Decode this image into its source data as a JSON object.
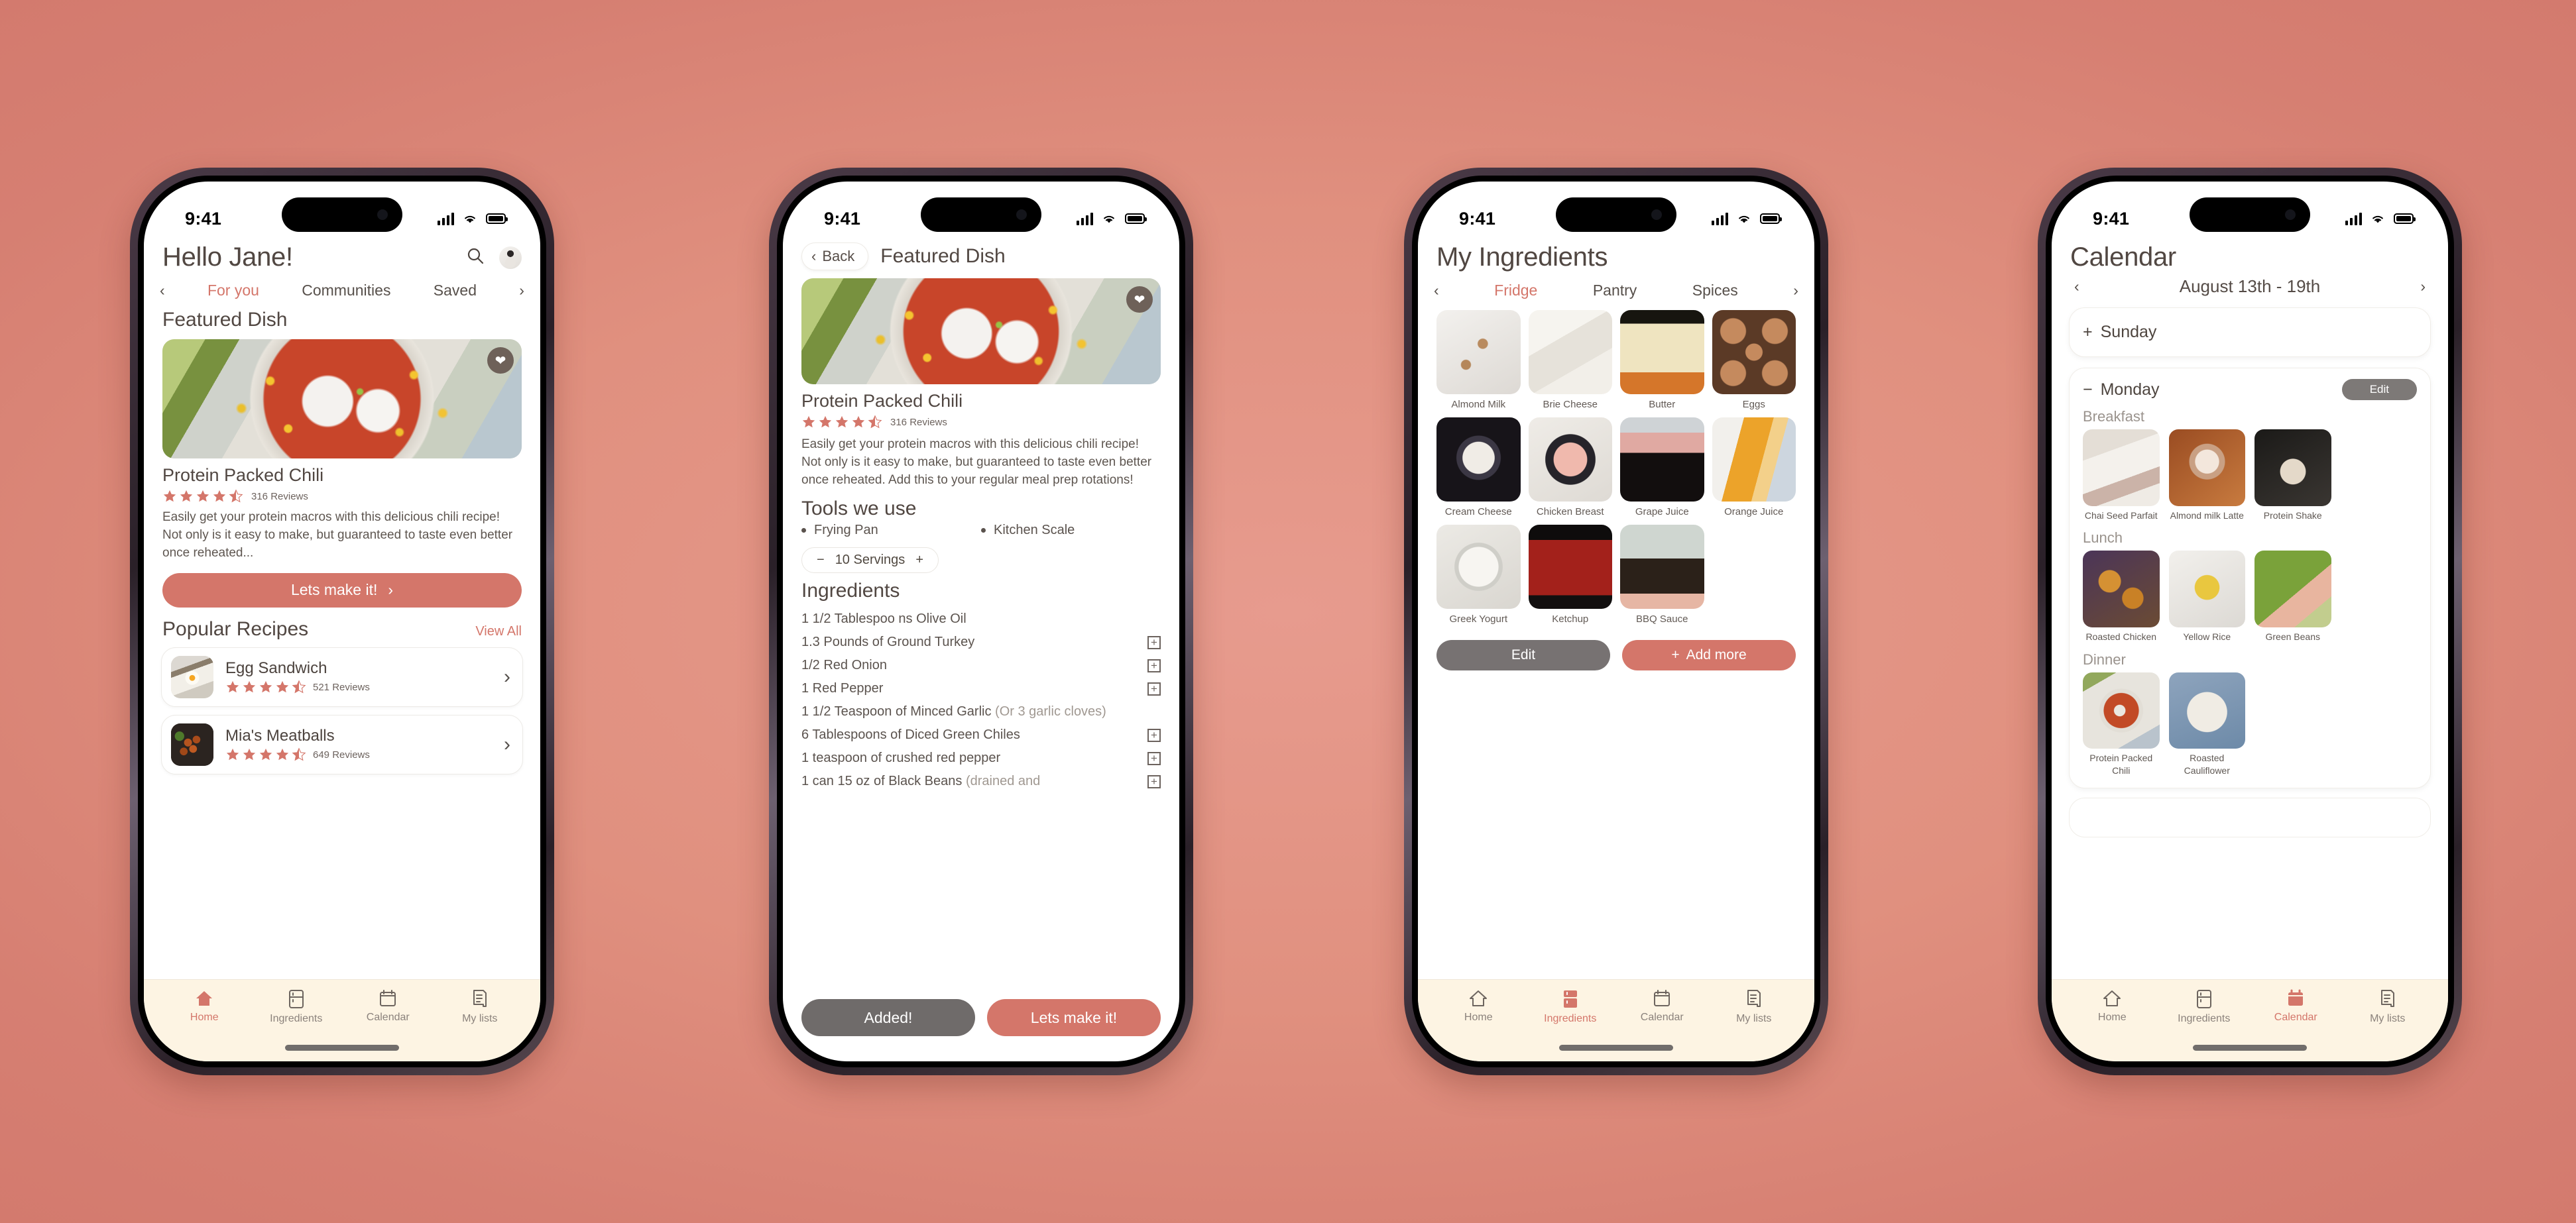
{
  "colors": {
    "accent": "#d4766a",
    "grey_button": "#777272",
    "tabbar_bg": "#fdf4e3",
    "text": "#514742",
    "background": "#d3766c"
  },
  "statusbar": {
    "time": "9:41"
  },
  "nav": {
    "items": [
      {
        "label": "Home",
        "icon": "home-icon"
      },
      {
        "label": "Ingredients",
        "icon": "fridge-icon"
      },
      {
        "label": "Calendar",
        "icon": "calendar-icon"
      },
      {
        "label": "My lists",
        "icon": "list-icon"
      }
    ]
  },
  "phone1": {
    "greeting": "Hello Jane!",
    "search_icon": "search-icon",
    "avatar": "user-avatar",
    "tabs": [
      {
        "label": "For you",
        "active": true
      },
      {
        "label": "Communities",
        "active": false
      },
      {
        "label": "Saved",
        "active": false
      }
    ],
    "prev_chevron": "‹",
    "next_chevron": "›",
    "featured_section_title": "Featured Dish",
    "featured": {
      "image": "protein-packed-chili-photo",
      "favorite_icon": "heart-icon",
      "title": "Protein Packed Chili",
      "rating": 4.5,
      "reviews": "316 Reviews",
      "description": "Easily get your protein macros with this delicious chili recipe! Not only is it easy to make, but guaranteed to taste even better once reheated...",
      "cta": "Lets make it!"
    },
    "popular": {
      "title": "Popular Recipes",
      "view_all": "View All",
      "items": [
        {
          "name": "Egg Sandwich",
          "rating": 4.5,
          "reviews": "521 Reviews",
          "thumb": "egg-sandwich-photo"
        },
        {
          "name": "Mia's Meatballs",
          "rating": 4.5,
          "reviews": "649 Reviews",
          "thumb": "meatballs-photo"
        }
      ]
    },
    "active_tab": "Home"
  },
  "phone2": {
    "back_label": "Back",
    "page_title": "Featured Dish",
    "hero_image": "protein-packed-chili-photo",
    "favorite_icon": "heart-icon",
    "title": "Protein Packed Chili",
    "rating": 4.5,
    "reviews": "316 Reviews",
    "description": "Easily get your protein macros with this delicious chili recipe! Not only is it easy to make, but guaranteed to taste even better once reheated. Add this to your regular meal prep rotations!",
    "tools_title": "Tools we use",
    "tools": [
      "Frying Pan",
      "Kitchen Scale"
    ],
    "servings": {
      "minus": "−",
      "label": "10 Servings",
      "plus": "+"
    },
    "ingredients_title": "Ingredients",
    "ingredients": [
      {
        "text": "1 1/2 Tablespoo ns Olive Oil",
        "note": "",
        "add": false
      },
      {
        "text": "1.3 Pounds of Ground Turkey",
        "note": "",
        "add": true
      },
      {
        "text": "1/2 Red Onion",
        "note": "",
        "add": true
      },
      {
        "text": "1 Red Pepper",
        "note": "",
        "add": true
      },
      {
        "text": "1 1/2 Teaspoon of Minced Garlic ",
        "note": "(Or 3 garlic cloves)",
        "add": false
      },
      {
        "text": "6 Tablespoons of Diced Green Chiles",
        "note": "",
        "add": true
      },
      {
        "text": "1 teaspoon of crushed red pepper",
        "note": "",
        "add": true
      },
      {
        "text": "1 can 15 oz of Black Beans ",
        "note": "(drained and",
        "add": true
      }
    ],
    "buttons": {
      "added": "Added!",
      "make": "Lets make it!"
    }
  },
  "phone3": {
    "page_title": "My Ingredients",
    "tabs": [
      {
        "label": "Fridge",
        "active": true
      },
      {
        "label": "Pantry",
        "active": false
      },
      {
        "label": "Spices",
        "active": false
      }
    ],
    "prev_chevron": "‹",
    "next_chevron": "›",
    "items": [
      {
        "label": "Almond Milk",
        "swatch": "sw-almondmilk"
      },
      {
        "label": "Brie Cheese",
        "swatch": "sw-brie"
      },
      {
        "label": "Butter",
        "swatch": "sw-butter"
      },
      {
        "label": "Eggs",
        "swatch": "sw-eggs"
      },
      {
        "label": "Cream Cheese",
        "swatch": "sw-creamcheese"
      },
      {
        "label": "Chicken Breast",
        "swatch": "sw-chicken"
      },
      {
        "label": "Grape Juice",
        "swatch": "sw-grape"
      },
      {
        "label": "Orange Juice",
        "swatch": "sw-oj"
      },
      {
        "label": "Greek Yogurt",
        "swatch": "sw-yogurt"
      },
      {
        "label": "Ketchup",
        "swatch": "sw-ketchup"
      },
      {
        "label": "BBQ Sauce",
        "swatch": "sw-bbq"
      }
    ],
    "edit_label": "Edit",
    "add_label": "Add more",
    "add_icon": "plus-icon",
    "active_tab": "Ingredients"
  },
  "phone4": {
    "page_title": "Calendar",
    "week_range": "August 13th - 19th",
    "prev_chevron": "‹",
    "next_chevron": "›",
    "collapsed_day": {
      "toggle": "+",
      "label": "Sunday"
    },
    "expanded_day": {
      "toggle": "−",
      "label": "Monday",
      "edit": "Edit"
    },
    "meals": [
      {
        "title": "Breakfast",
        "items": [
          {
            "label": "Chai Seed Parfait",
            "swatch": "sw-parfait"
          },
          {
            "label": "Almond milk Latte",
            "swatch": "sw-latte"
          },
          {
            "label": "Protein Shake",
            "swatch": "sw-shake"
          }
        ]
      },
      {
        "title": "Lunch",
        "items": [
          {
            "label": "Roasted Chicken",
            "swatch": "sw-roastchicken"
          },
          {
            "label": "Yellow Rice",
            "swatch": "sw-rice"
          },
          {
            "label": "Green Beans",
            "swatch": "sw-greenbeans"
          }
        ]
      },
      {
        "title": "Dinner",
        "items": [
          {
            "label": "Protein Packed Chili",
            "swatch": "sw-chili"
          },
          {
            "label": "Roasted Cauliflower",
            "swatch": "sw-cauliflower"
          }
        ]
      }
    ],
    "active_tab": "Calendar"
  }
}
